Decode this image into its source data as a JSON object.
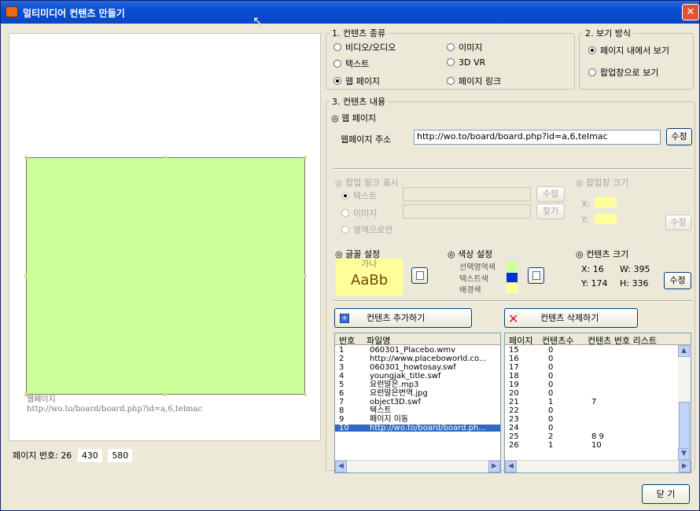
{
  "window": {
    "title": "멀티미디어 컨텐츠 만들기",
    "close_glyph": "✕"
  },
  "preview": {
    "caption_type": "웹페이지",
    "caption_url": "http://wo.to/board/board.php?id=a,6,telmac",
    "page_label": "페이지 번호:",
    "page_num": "26",
    "coord1": "430",
    "coord2": "580"
  },
  "content_type": {
    "legend": "1. 컨텐츠 종류",
    "options": [
      "비디오/오디오",
      "이미지",
      "텍스트",
      "3D VR",
      "웹 페이지",
      "페이지 링크"
    ],
    "selected": "웹 페이지"
  },
  "view_mode": {
    "legend": "2. 보기 방식",
    "options": [
      "페이지 내에서 보기",
      "팝업창으로 보기"
    ],
    "selected": "페이지 내에서 보기"
  },
  "content": {
    "legend": "3. 컨텐츠 내용",
    "section": "◎ 웹 페이지",
    "url_label": "웹페이지 주소",
    "url_value": "http://wo.to/board/board.php?id=a,6,telmac",
    "edit": "수정"
  },
  "popup_link": {
    "title": "◎ 팝업 링크 표시",
    "opt_text": "텍스트",
    "opt_image": "이미지",
    "opt_area": "영역으로만",
    "edit": "수정",
    "find": "찾기"
  },
  "popup_size": {
    "title": "◎ 팝업창 크기",
    "x": "X:",
    "y": "Y:",
    "edit": "수정"
  },
  "font": {
    "title": "◎ 글꼴 설정",
    "sample_top": "가나",
    "sample": "AaBb"
  },
  "color": {
    "title": "◎ 색상 설정",
    "select_area": "선택영역색",
    "text": "텍스트색",
    "bg": "배경색",
    "swatch_area": "#ccff99",
    "swatch_text": "#0033cc",
    "swatch_bg": "#ffff99"
  },
  "content_size": {
    "title": "◎ 컨텐츠 크기",
    "x_label": "X:",
    "x": "16",
    "w_label": "W:",
    "w": "395",
    "y_label": "Y:",
    "y": "174",
    "h_label": "H:",
    "h": "336",
    "edit": "수정"
  },
  "actions": {
    "add": "컨텐츠 추가하기",
    "delete": "컨텐츠 삭제하기",
    "close": "닫 기"
  },
  "file_list": {
    "headers": [
      "번호",
      "파일명"
    ],
    "rows": [
      [
        "1",
        "060301_Placebo.wmv"
      ],
      [
        "2",
        "http://www.placeboworld.co..."
      ],
      [
        "3",
        "060301_howtosay.swf"
      ],
      [
        "4",
        "youngjak_title.swf"
      ],
      [
        "5",
        "요런말은.mp3"
      ],
      [
        "6",
        "요런말은번역.jpg"
      ],
      [
        "7",
        "object3D.swf"
      ],
      [
        "8",
        "텍스트"
      ],
      [
        "9",
        "페이지 이동"
      ],
      [
        "10",
        "http://wo.to/board/board.ph..."
      ]
    ],
    "selected_index": 9
  },
  "page_list": {
    "headers": [
      "페이지",
      "컨텐츠수",
      "컨텐츠 번호 리스트"
    ],
    "rows": [
      [
        "15",
        "0",
        ""
      ],
      [
        "16",
        "0",
        ""
      ],
      [
        "17",
        "0",
        ""
      ],
      [
        "18",
        "0",
        ""
      ],
      [
        "19",
        "0",
        ""
      ],
      [
        "20",
        "0",
        ""
      ],
      [
        "21",
        "1",
        "7"
      ],
      [
        "22",
        "0",
        ""
      ],
      [
        "23",
        "0",
        ""
      ],
      [
        "24",
        "0",
        ""
      ],
      [
        "25",
        "2",
        "8 9"
      ],
      [
        "26",
        "1",
        "10"
      ]
    ]
  }
}
